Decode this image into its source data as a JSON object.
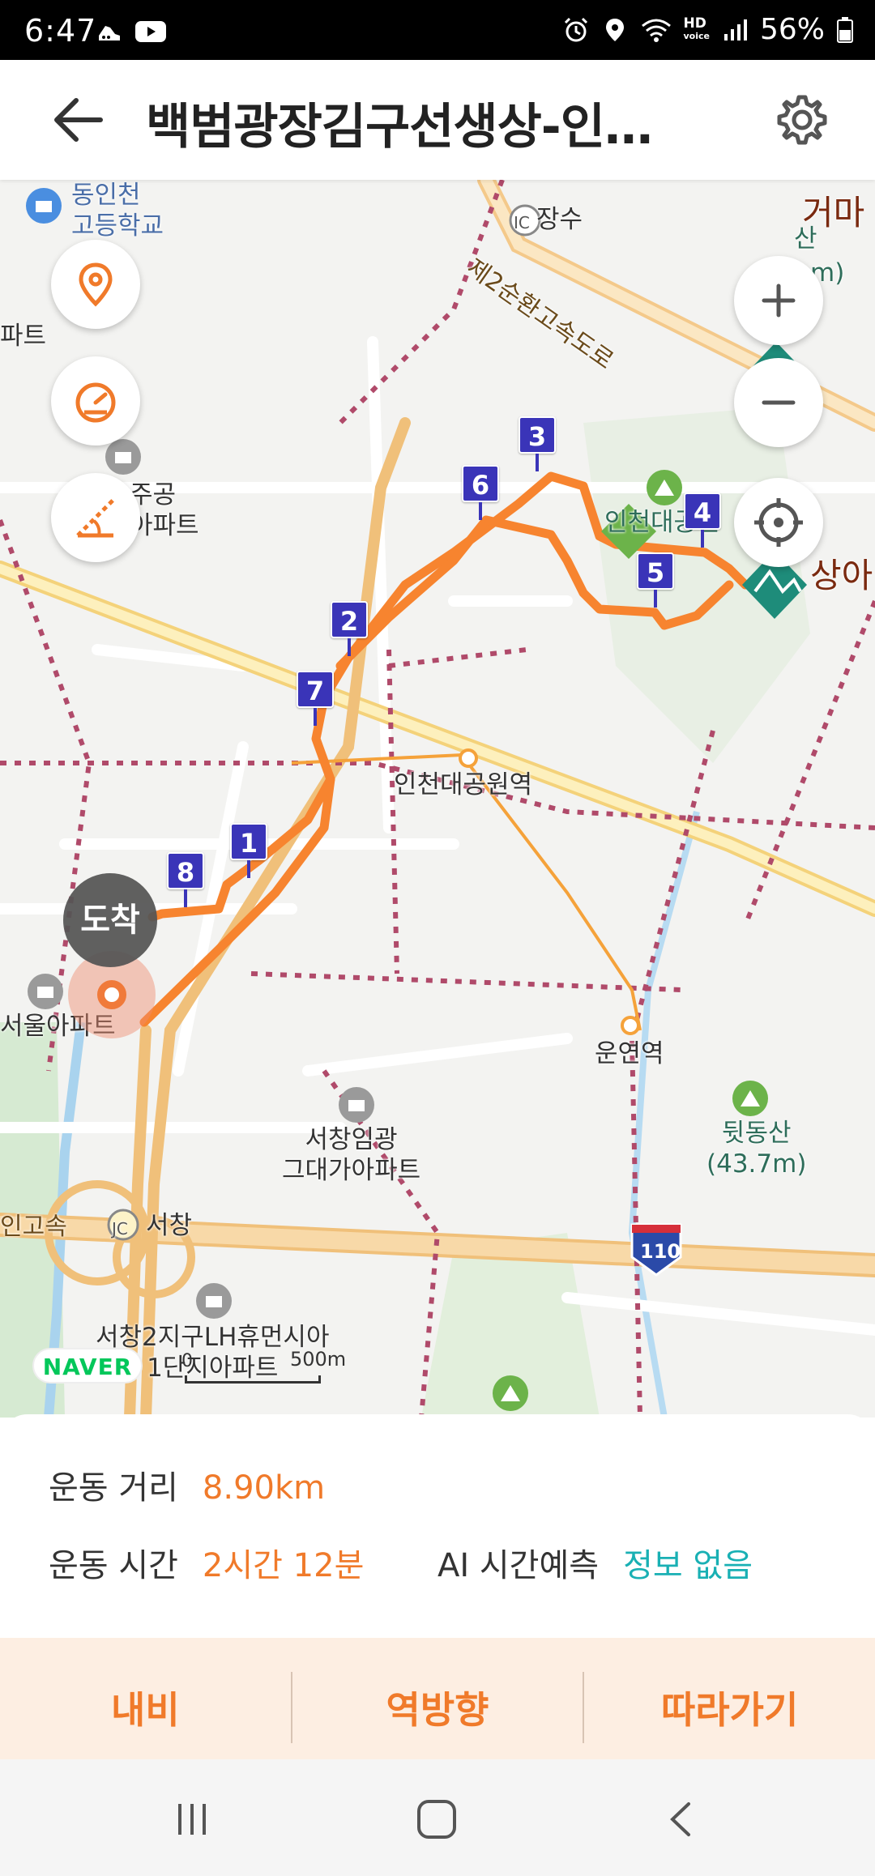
{
  "status_bar": {
    "time": "6:47",
    "battery": "56%",
    "left_icons": [
      "running-shoe-icon",
      "youtube-icon"
    ],
    "right_icons": [
      "alarm-icon",
      "location-icon",
      "wifi-icon",
      "hd-voice-icon",
      "signal-icon",
      "battery-icon"
    ],
    "hd_label": "HD",
    "voice_label": "voice"
  },
  "header": {
    "title": "백범광장김구선생상-인…",
    "back_icon": "arrow-left-icon",
    "settings_icon": "gear-icon"
  },
  "map": {
    "labels": {
      "school": "동인천\n고등학교",
      "apt_left": "파트",
      "ic": "IC",
      "jangsu": "장수",
      "expressway": "제2순환고속도로",
      "mountain_top": "거마",
      "mountain_top_sub": "산",
      "mountain_top_height": "m)",
      "jugong": "주공\n아파트",
      "park": "인천대공원",
      "mountain_right": "상아",
      "station_park": "인천대공원역",
      "seoul_apt": "서울아파트",
      "station_unyeon": "운연역",
      "seochang_apt": "서창임광\n그대가아파트",
      "dwitdong": "뒷동산\n(43.7m)",
      "expressway_left": "인고속",
      "jc": "JC",
      "seochang": "서창",
      "route": "110",
      "lh_apt": "서창2지구LH휴먼시아\n1단지아파트"
    },
    "waypoints": [
      "1",
      "2",
      "3",
      "4",
      "5",
      "6",
      "7",
      "8"
    ],
    "arrive_label": "도착",
    "naver": "NAVER",
    "scale_zero": "0",
    "scale_distance": "500m",
    "buttons": {
      "marker": "location-pin-icon",
      "speed": "speedometer-icon",
      "elevation": "elevation-icon",
      "zoom_in": "plus-icon",
      "zoom_out": "minus-icon",
      "locate": "crosshair-icon"
    },
    "route_color": "#f7842f",
    "waypoint_color": "#3a34b8"
  },
  "info": {
    "distance_label": "운동 거리",
    "distance_value": "8.90km",
    "time_label": "운동 시간",
    "time_value": "2시간 12분",
    "ai_label": "AI 시간예측",
    "ai_value": "정보 없음"
  },
  "actions": {
    "navi": "내비",
    "reverse": "역방향",
    "follow": "따라가기"
  },
  "nav_bar": {
    "recent_icon": "recent-apps-icon",
    "home_icon": "home-icon",
    "back_icon": "back-chevron-icon"
  }
}
